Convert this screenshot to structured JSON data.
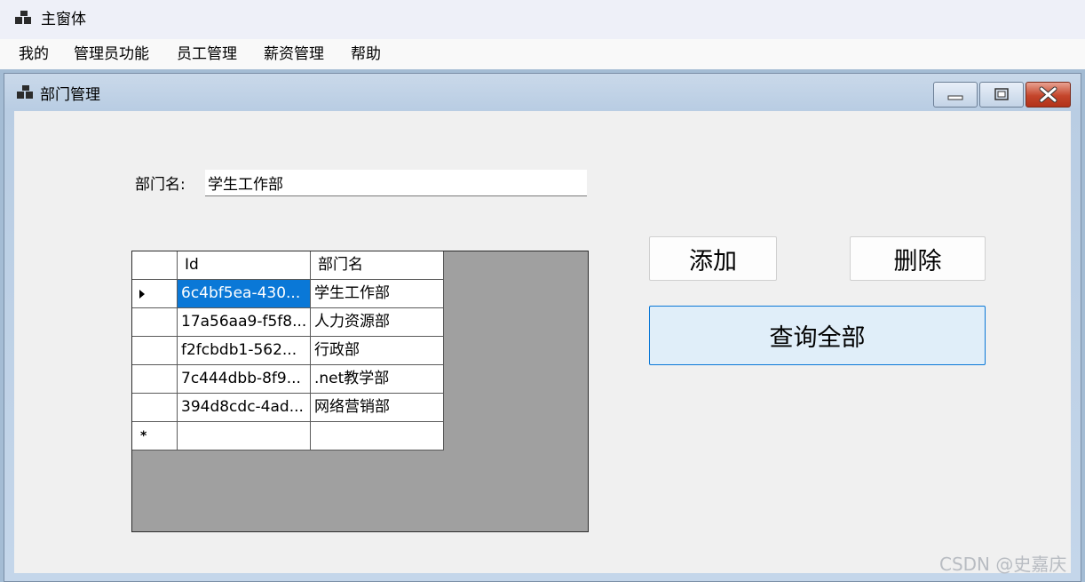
{
  "main_window": {
    "title": "主窗体",
    "icon": "app-window-icon"
  },
  "menu": [
    "我的",
    "管理员功能",
    "员工管理",
    "薪资管理",
    "帮助"
  ],
  "child_window": {
    "title": "部门管理",
    "icon": "form-icon",
    "controls": {
      "minimize": "minimize-icon",
      "maximize": "maximize-icon",
      "close": "close-icon"
    }
  },
  "form": {
    "dept_label": "部门名:",
    "dept_value": "学生工作部",
    "add_label": "添加",
    "delete_label": "删除",
    "query_label": "查询全部"
  },
  "grid": {
    "columns": [
      "Id",
      "部门名"
    ],
    "rows": [
      [
        "6c4bf5ea-430...",
        "学生工作部"
      ],
      [
        "17a56aa9-f5f8...",
        "人力资源部"
      ],
      [
        "f2fcbdb1-562...",
        "行政部"
      ],
      [
        "7c444dbb-8f9...",
        ".net教学部"
      ],
      [
        "394d8cdc-4ad...",
        "网络营销部"
      ]
    ],
    "selected_row": 0,
    "new_row_marker": "*"
  },
  "watermark": "CSDN @史嘉庆",
  "colors": {
    "selection": "#0a78d7",
    "grid_background": "#a0a0a0",
    "close_button": "#c4452b",
    "query_button": "#e0eef9"
  }
}
